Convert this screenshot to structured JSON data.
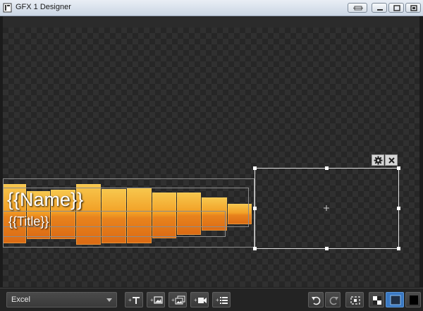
{
  "window": {
    "title": "GFX 1 Designer"
  },
  "canvas": {
    "name_placeholder": "{{Name}}",
    "title_placeholder": "{{Title}}",
    "bar_color": "#f2a026"
  },
  "selection_tools": {
    "settings_icon": "gear-icon",
    "delete_icon": "close-icon"
  },
  "toolbar": {
    "source": "Excel",
    "buttons": [
      "add-text-icon",
      "add-image-icon",
      "add-gallery-icon",
      "add-video-icon",
      "add-list-icon"
    ],
    "undo_icon": "undo-icon",
    "redo_icon": "redo-icon",
    "fit_icon": "fit-screen-icon",
    "backgrounds": [
      "checker-background",
      "blue-background",
      "black-background"
    ],
    "active_background": "blue-background"
  },
  "colors": {
    "accent": "#3a78c2",
    "canvas_dark": "#262626",
    "canvas_light": "#303030"
  }
}
